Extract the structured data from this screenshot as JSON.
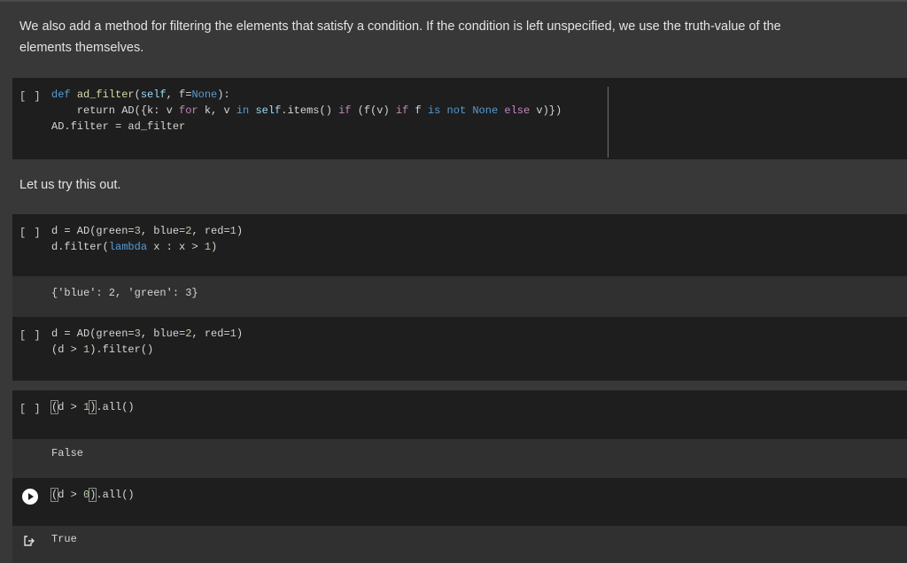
{
  "text1": "We also add a method for filtering the elements that satisfy a condition. If the condition is left unspecified, we use the truth-value of the elements themselves.",
  "text2": "Let us try this out.",
  "gutter_brackets": "[ ]",
  "cell1": {
    "line1": [
      "def",
      " ",
      "ad_filter",
      "(",
      "self",
      ", f=",
      "None",
      "):"
    ],
    "line2": [
      "    return AD({k: v ",
      "for",
      " k, v ",
      "in",
      " ",
      "self",
      ".items() ",
      "if",
      " (f(v) ",
      "if",
      " f ",
      "is not",
      " ",
      "None",
      " ",
      "else",
      " v)})"
    ],
    "line3": "AD.filter = ad_filter"
  },
  "cell2": {
    "line1": [
      "d = AD(green=",
      "3",
      ", blue=",
      "2",
      ", red=",
      "1",
      ")"
    ],
    "line2": [
      "d.filter(",
      "lambda",
      " x : x > ",
      "1",
      ")"
    ],
    "output": "{'blue': 2, 'green': 3}"
  },
  "cell3": {
    "line1": [
      "d = AD(green=",
      "3",
      ", blue=",
      "2",
      ", red=",
      "1",
      ")"
    ],
    "line2": [
      "(d > ",
      "1",
      ").filter()"
    ]
  },
  "cell4": {
    "line1": [
      "(",
      "d > ",
      "1",
      ")",
      ".all()"
    ],
    "output": "False"
  },
  "cell5": {
    "line1": [
      "(",
      "d > ",
      "0",
      ")",
      ".all()"
    ],
    "output": "True"
  }
}
